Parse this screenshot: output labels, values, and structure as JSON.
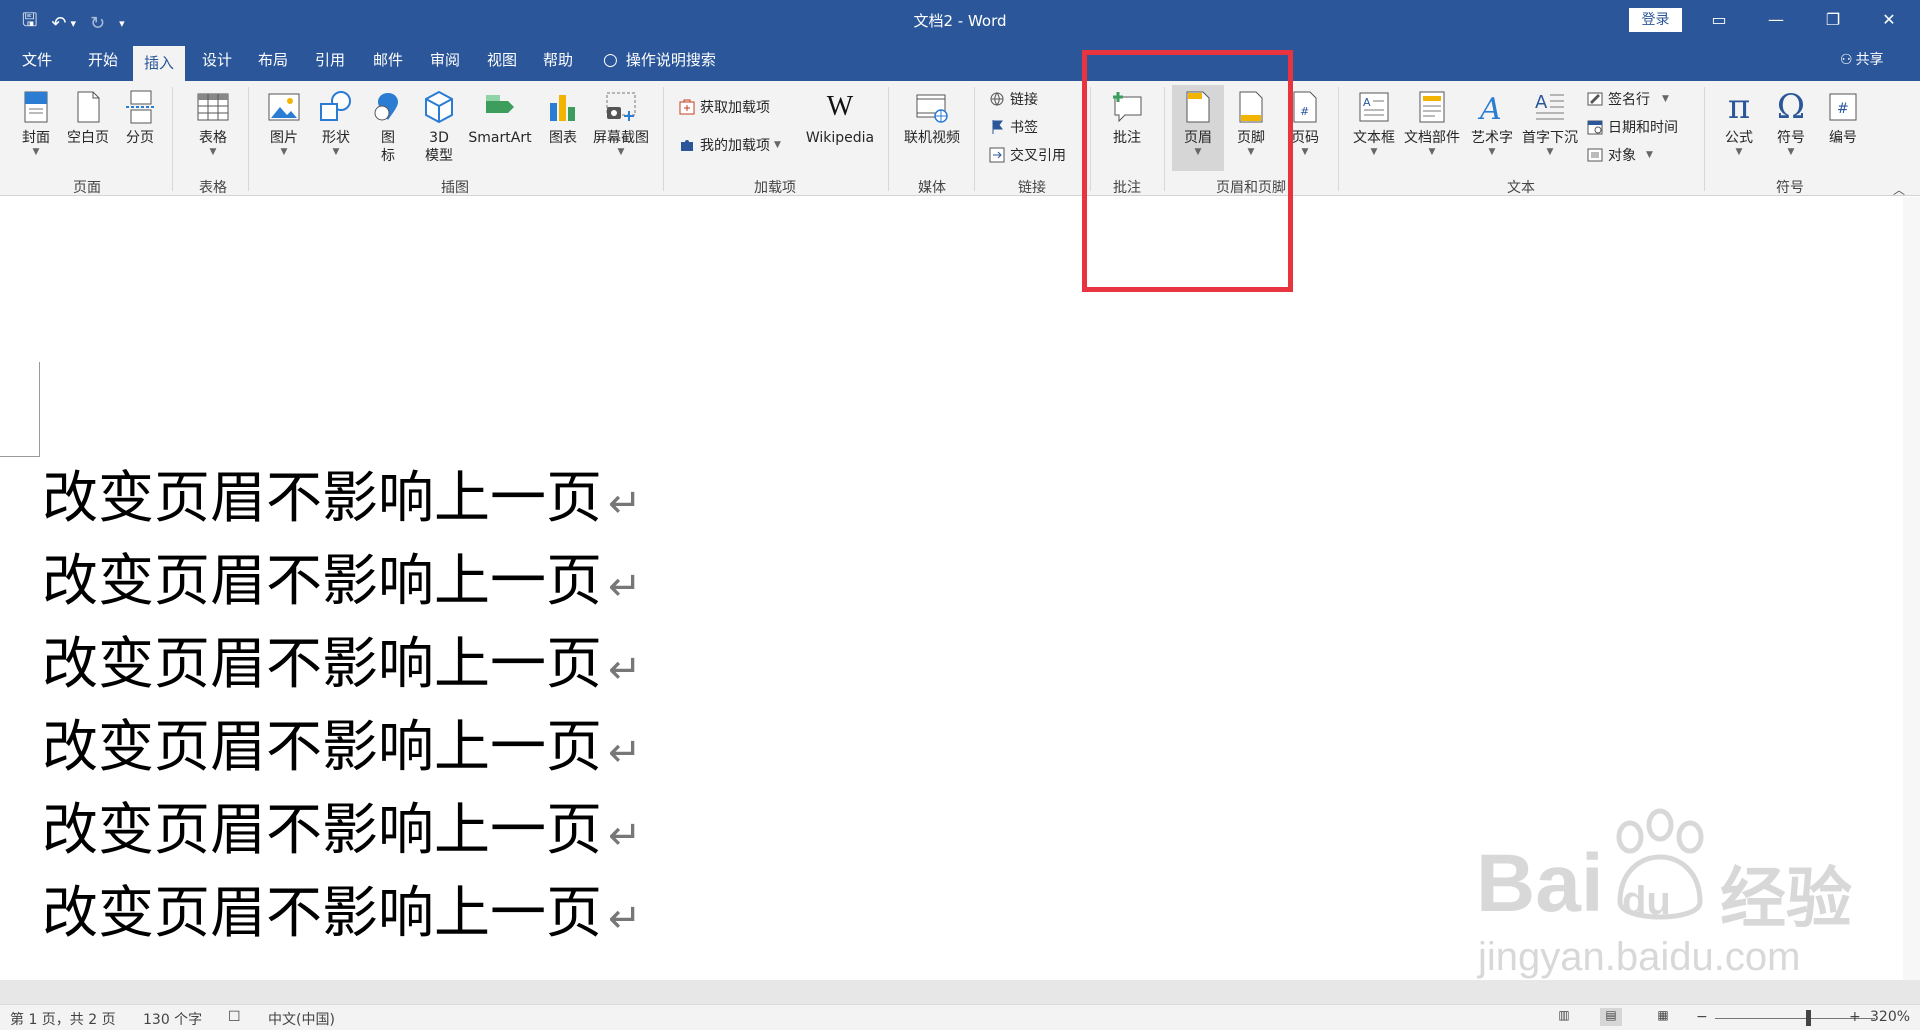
{
  "titlebar": {
    "title": "文档2 - Word",
    "login": "登录",
    "qat": {
      "save": "🖫",
      "undo": "↶",
      "undo_arrow": "▾",
      "redo": "↻",
      "customize": "▾"
    },
    "controls": {
      "ribbon_display": "▭",
      "minimize": "—",
      "restore": "❐",
      "close": "✕"
    }
  },
  "tabs": [
    "文件",
    "开始",
    "插入",
    "设计",
    "布局",
    "引用",
    "邮件",
    "审阅",
    "视图",
    "帮助"
  ],
  "active_tab": "插入",
  "tell_me": "操作说明搜索",
  "share": "共享",
  "ribbon": {
    "groups": {
      "pages": "页面",
      "tables": "表格",
      "illustrations": "插图",
      "addins": "加载项",
      "media": "媒体",
      "links": "链接",
      "comments": "批注",
      "header_footer": "页眉和页脚",
      "text": "文本",
      "symbols": "符号"
    },
    "buttons": {
      "cover": "封面",
      "blank_page": "空白页",
      "page_break": "分页",
      "table": "表格",
      "pictures": "图片",
      "shapes": "形状",
      "icons_1": "图",
      "icons_2": "标",
      "model3d_1": "3D",
      "model3d_2": "模型",
      "smartart": "SmartArt",
      "chart": "图表",
      "screenshot": "屏幕截图",
      "get_addins": "获取加载项",
      "my_addins": "我的加载项",
      "wikipedia": "Wikipedia",
      "online_video": "联机视频",
      "link": "链接",
      "bookmark": "书签",
      "cross_ref": "交叉引用",
      "comment": "批注",
      "header": "页眉",
      "footer": "页脚",
      "page_number": "页码",
      "text_box": "文本框",
      "quick_parts": "文档部件",
      "wordart": "艺术字",
      "drop_cap": "首字下沉",
      "signature_line": "签名行",
      "date_time": "日期和时间",
      "object": "对象",
      "equation": "公式",
      "symbol": "符号",
      "number": "编号"
    }
  },
  "document": {
    "lines": [
      "改变页眉不影响上一页",
      "改变页眉不影响上一页",
      "改变页眉不影响上一页",
      "改变页眉不影响上一页",
      "改变页眉不影响上一页",
      "改变页眉不影响上一页"
    ],
    "paragraph_mark": "↵"
  },
  "watermark": {
    "brand": "Bai",
    "paw_text": "du",
    "cn": "经验",
    "url": "jingyan.baidu.com"
  },
  "status": {
    "page": "第 1 页，共 2 页",
    "words": "130 个字",
    "language": "中文(中国)",
    "zoom_minus": "−",
    "zoom_plus": "+",
    "zoom": "320%"
  },
  "colors": {
    "ribbon_blue": "#2b579a",
    "highlight_red": "#e8343e"
  }
}
